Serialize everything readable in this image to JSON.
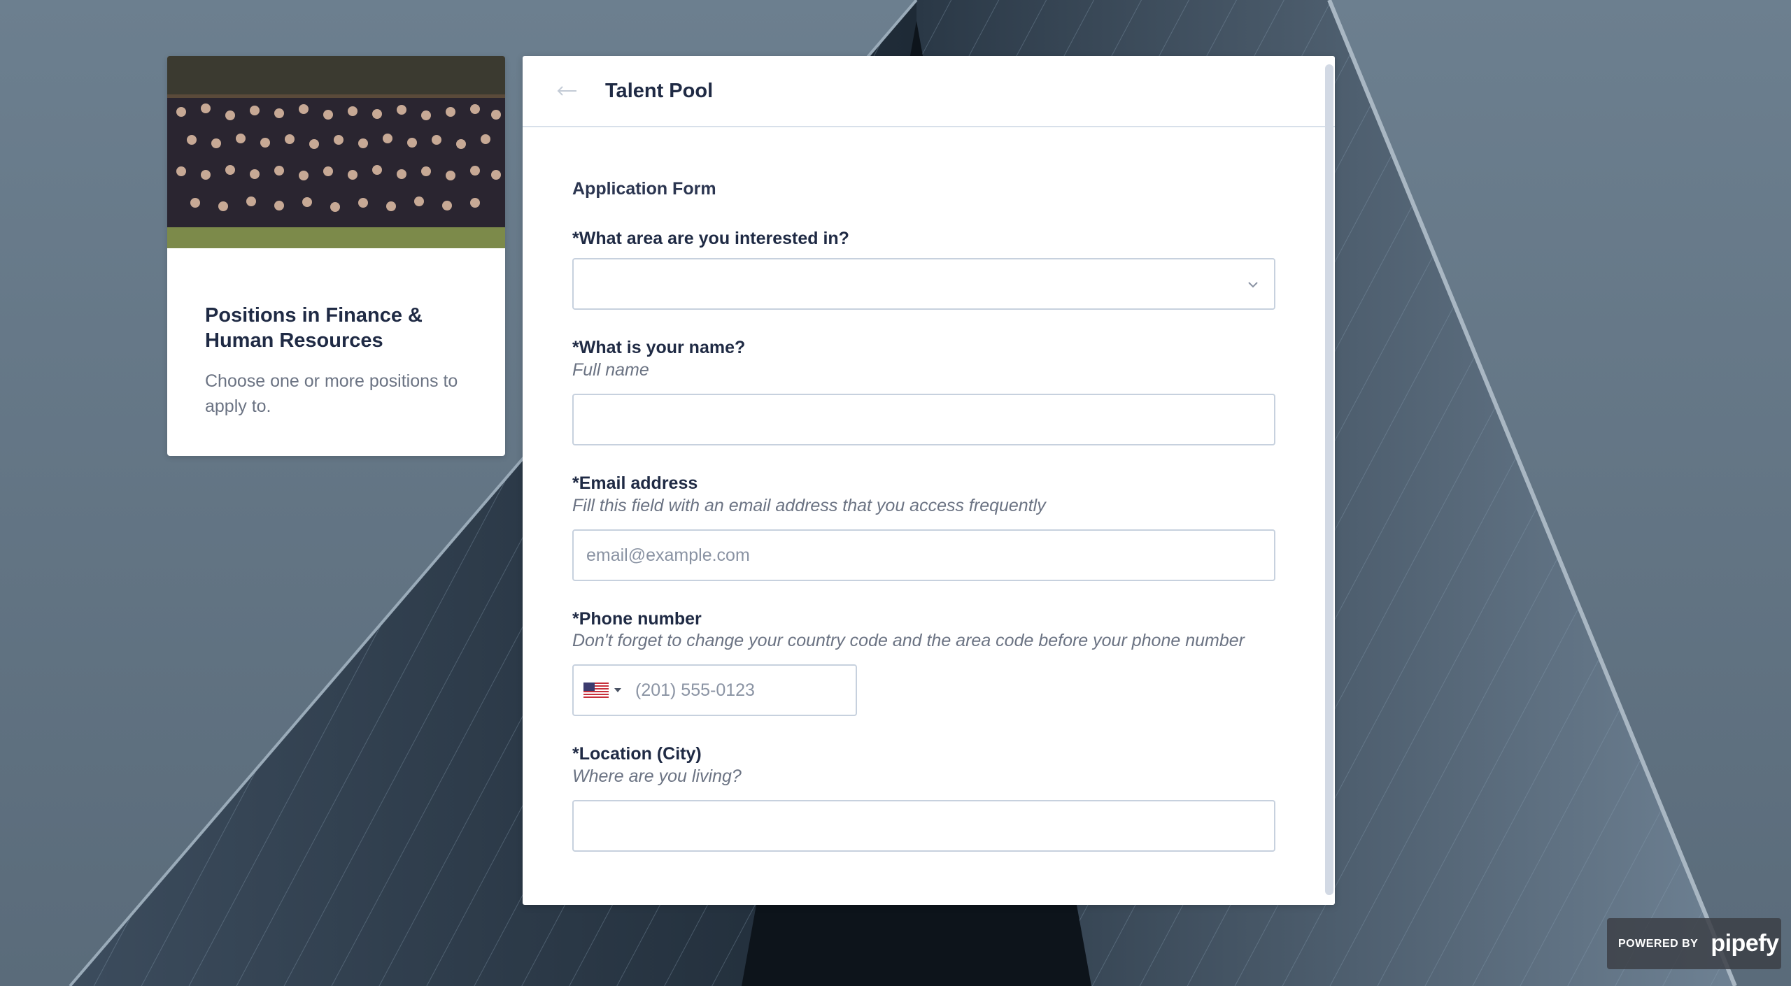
{
  "side_card": {
    "title": "Positions in Finance & Human Resources",
    "description": "Choose one or more positions to apply to."
  },
  "header": {
    "title": "Talent Pool",
    "back_icon": "arrow-left-icon"
  },
  "form": {
    "heading": "Application Form",
    "area": {
      "label": "*What area are you interested in?",
      "value": ""
    },
    "name": {
      "label": "*What is your name?",
      "help": "Full name",
      "value": ""
    },
    "email": {
      "label": "*Email address",
      "help": "Fill this field with an email address that you access frequently",
      "placeholder": "email@example.com"
    },
    "phone": {
      "label": "*Phone number",
      "help": "Don't forget to change your country code and the area code before your phone number",
      "country_flag": "us-flag-icon",
      "placeholder": "(201) 555-0123"
    },
    "location": {
      "label": "*Location (City)",
      "help": "Where are you living?",
      "value": ""
    }
  },
  "footer": {
    "powered_label": "POWERED BY",
    "brand": "pipefy"
  },
  "colors": {
    "text_primary": "#1f2a44",
    "text_muted": "#6b7383",
    "border": "#c7d1de"
  }
}
